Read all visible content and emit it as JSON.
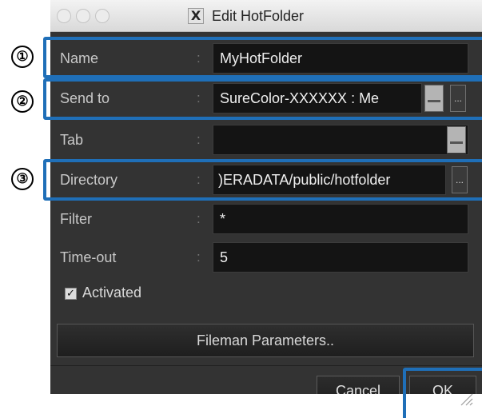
{
  "window": {
    "title": "Edit HotFolder",
    "title_icon_glyph": "X"
  },
  "fields": {
    "name": {
      "label": "Name",
      "value": "MyHotFolder"
    },
    "send_to": {
      "label": "Send to",
      "value": "SureColor-XXXXXX : Me",
      "more_label": "..."
    },
    "tab": {
      "label": "Tab",
      "value": ""
    },
    "directory": {
      "label": "Directory",
      "value": ")ERADATA/public/hotfolder",
      "more_label": "..."
    },
    "filter": {
      "label": "Filter",
      "value": "*"
    },
    "timeout": {
      "label": "Time-out",
      "value": "5"
    }
  },
  "separator": ":",
  "activated": {
    "label": "Activated",
    "checked": true,
    "check_glyph": "✓"
  },
  "fileman_button": "Fileman Parameters..",
  "buttons": {
    "cancel": "Cancel",
    "ok": "OK"
  },
  "callouts": [
    "①",
    "②",
    "③"
  ],
  "colors": {
    "highlight": "#1f6fb8",
    "window_bg": "#333333",
    "field_bg": "#141414"
  }
}
